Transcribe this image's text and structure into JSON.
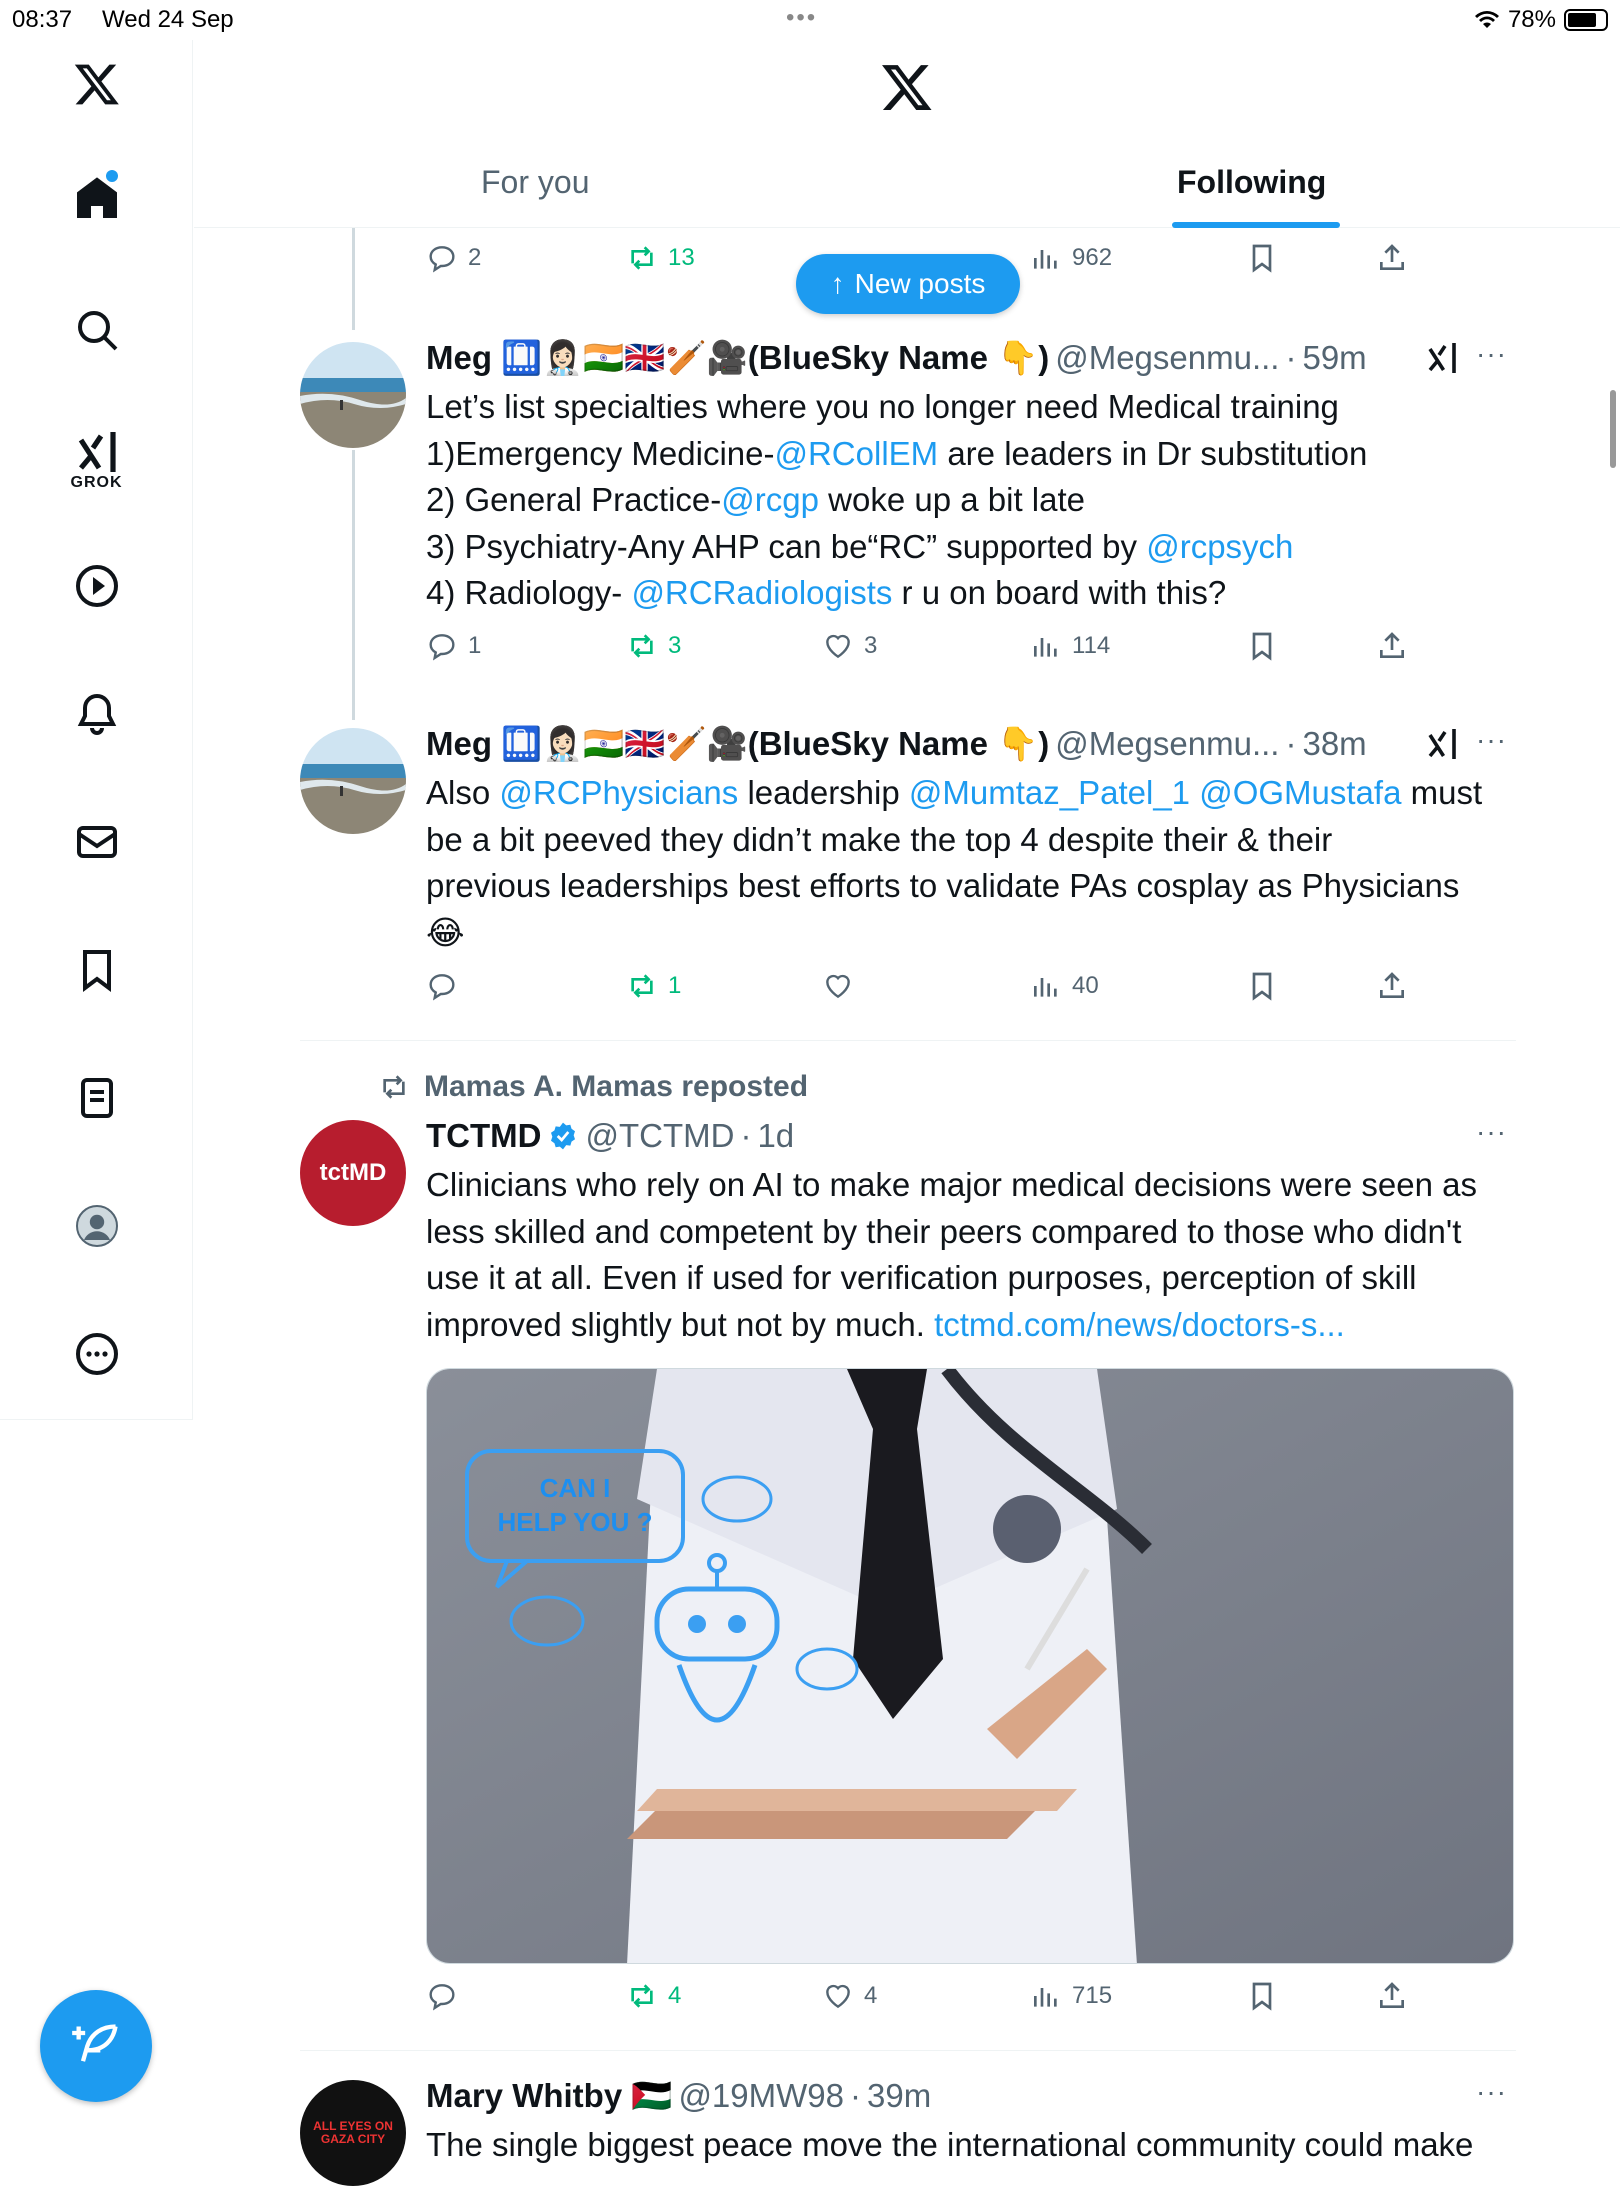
{
  "status": {
    "time": "08:37",
    "date": "Wed 24 Sep",
    "battery": "78%"
  },
  "sidebar": {
    "grok_label": "GROK"
  },
  "header": {
    "tabs": [
      {
        "label": "For you"
      },
      {
        "label": "Following"
      }
    ],
    "active_tab": "Following"
  },
  "new_posts_label": "New posts",
  "top_actions": {
    "replies": "2",
    "reposts": "13",
    "views": "962"
  },
  "tweets": [
    {
      "name": "Meg 🛄👩🏻‍⚕️🇮🇳🇬🇧🏏🎥(BlueSky Name 👇)",
      "handle": "@Megsenmu...",
      "time": "59m",
      "lines": [
        [
          {
            "t": "Let’s list specialties where you no longer need Medical training"
          }
        ],
        [
          {
            "t": "1)Emergency Medicine-"
          },
          {
            "t": "@RCollEM",
            "link": true
          },
          {
            "t": " are leaders in Dr substitution"
          }
        ],
        [
          {
            "t": "2) General Practice-"
          },
          {
            "t": "@rcgp",
            "link": true
          },
          {
            "t": " woke up a bit late"
          }
        ],
        [
          {
            "t": "3) Psychiatry-Any AHP can be“RC” supported by "
          },
          {
            "t": "@rcpsych",
            "link": true
          }
        ],
        [
          {
            "t": "4) Radiology- "
          },
          {
            "t": "@RCRadiologists",
            "link": true
          },
          {
            "t": " r u on board with this?"
          }
        ]
      ],
      "replies": "1",
      "reposts": "3",
      "likes": "3",
      "views": "114"
    },
    {
      "name": "Meg 🛄👩🏻‍⚕️🇮🇳🇬🇧🏏🎥(BlueSky Name 👇)",
      "handle": "@Megsenmu...",
      "time": "38m",
      "lines": [
        [
          {
            "t": "Also "
          },
          {
            "t": "@RCPhysicians",
            "link": true
          },
          {
            "t": " leadership "
          },
          {
            "t": "@Mumtaz_Patel_1",
            "link": true
          },
          {
            "t": " "
          },
          {
            "t": "@OGMustafa",
            "link": true
          },
          {
            "t": " must"
          }
        ],
        [
          {
            "t": "be a bit peeved they didn’t make the top 4 despite their & their"
          }
        ],
        [
          {
            "t": "previous leaderships best efforts to validate PAs cosplay as Physicians"
          }
        ],
        [
          {
            "t": "😂"
          }
        ]
      ],
      "replies": "",
      "reposts": "1",
      "likes": "",
      "views": "40"
    },
    {
      "repost_by": "Mamas A. Mamas reposted",
      "name": "TCTMD",
      "handle": "@TCTMD",
      "time": "1d",
      "avatar_text": "tctMD",
      "lines": [
        [
          {
            "t": "Clinicians who rely on AI to make major medical decisions were seen as"
          }
        ],
        [
          {
            "t": "less skilled and competent by their peers compared to those who didn't"
          }
        ],
        [
          {
            "t": "use it at all. Even if used for verification purposes, perception of skill"
          }
        ],
        [
          {
            "t": "improved slightly but not by much. "
          },
          {
            "t": "tctmd.com/news/doctors-s...",
            "link": true
          }
        ]
      ],
      "image_text": [
        "CAN I",
        "HELP YOU ?"
      ],
      "replies": "",
      "reposts": "4",
      "likes": "4",
      "views": "715"
    },
    {
      "name": "Mary Whitby 🇵🇸",
      "handle": "@19MW98",
      "time": "39m",
      "avatar_text": "ALL EYES ON GAZA CITY",
      "lines": [
        [
          {
            "t": "The single biggest peace move the international community could make"
          }
        ]
      ]
    }
  ]
}
